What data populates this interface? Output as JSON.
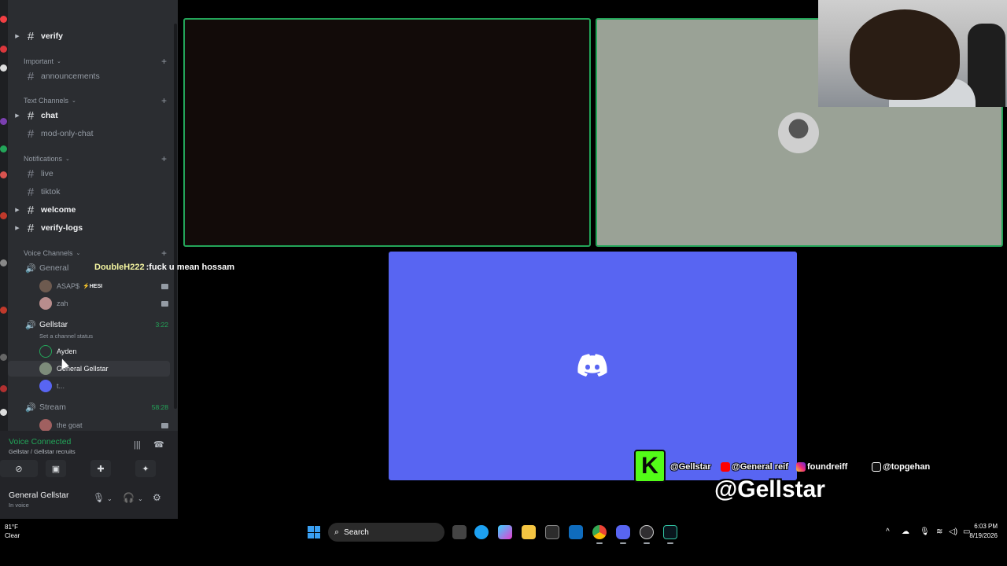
{
  "sidebar": {
    "channels_top": [
      {
        "name": "verify",
        "bold": true,
        "caret": true
      },
      {
        "name": "announcements",
        "bold": false,
        "caret": false
      }
    ],
    "categories": {
      "important": "Important",
      "text": "Text Channels",
      "notifications": "Notifications",
      "voice": "Voice Channels"
    },
    "text_channels": [
      {
        "name": "chat",
        "bold": true
      },
      {
        "name": "mod-only-chat",
        "bold": false
      }
    ],
    "notification_channels": [
      {
        "name": "live",
        "bold": false
      },
      {
        "name": "tiktok",
        "bold": false
      },
      {
        "name": "welcome",
        "bold": true
      },
      {
        "name": "verify-logs",
        "bold": true
      }
    ],
    "voice_channels": [
      {
        "name": "General",
        "members": [
          {
            "name": "ASAP$",
            "tag": "⚡HESI"
          },
          {
            "name": "zah",
            "tag": ""
          }
        ]
      },
      {
        "name": "Gellstar",
        "timer": "3:22",
        "status": "Set a channel status",
        "members": [
          {
            "name": "Ayden"
          },
          {
            "name": "General Gellstar"
          },
          {
            "name": "t..."
          }
        ]
      },
      {
        "name": "Stream",
        "timer": "58:28",
        "members": [
          {
            "name": "the goat"
          }
        ]
      }
    ]
  },
  "voice_panel": {
    "title": "Voice Connected",
    "subtitle": "Gellstar / Gellstar recruits"
  },
  "user": {
    "name": "General Gellstar",
    "status": "In voice"
  },
  "chat_overlay": {
    "user": "DoubleH222",
    "text": ":fuck u mean hossam"
  },
  "socials": {
    "kick": "K",
    "handles": [
      "@Gellstar",
      "@General reif",
      "foundreiff",
      "@topgehan"
    ],
    "big_handle": "@Gellstar"
  },
  "taskbar": {
    "weather_temp": "81°F",
    "weather_cond": "Clear",
    "search_label": "Search",
    "time": "6:03 PM",
    "date": "8/19/2026"
  },
  "colors": {
    "discord_blurple": "#5865f2",
    "voice_green": "#23a559",
    "kick_green": "#53fc18"
  }
}
